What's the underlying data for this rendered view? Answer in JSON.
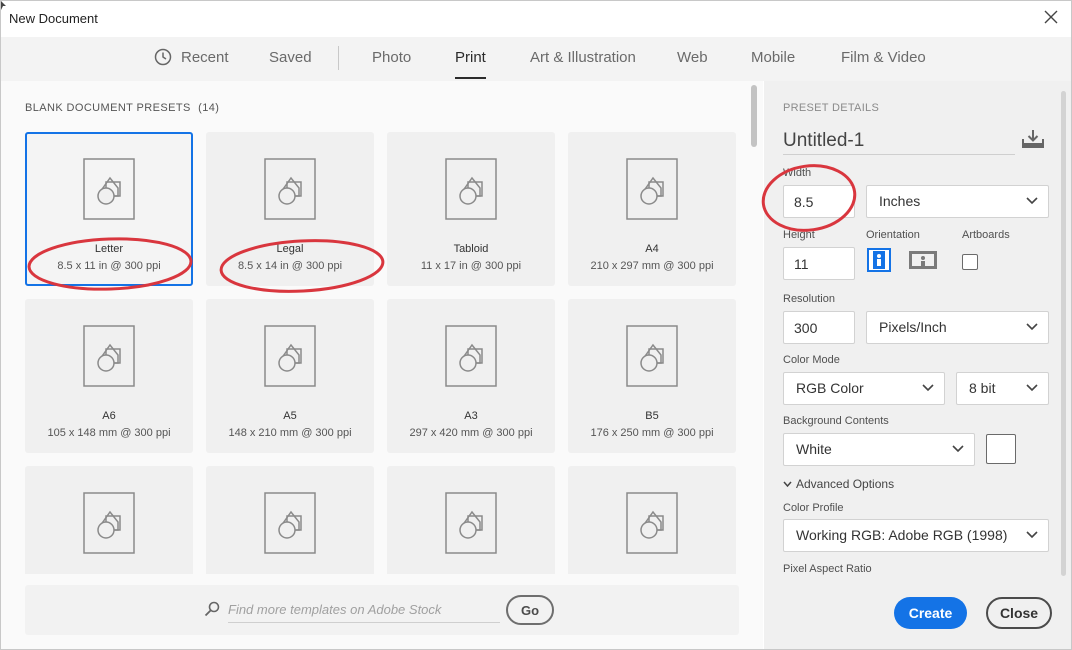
{
  "window": {
    "title": "New Document"
  },
  "tabs": [
    {
      "label": "Recent"
    },
    {
      "label": "Saved"
    },
    {
      "label": "Photo"
    },
    {
      "label": "Print",
      "active": true
    },
    {
      "label": "Art & Illustration"
    },
    {
      "label": "Web"
    },
    {
      "label": "Mobile"
    },
    {
      "label": "Film & Video"
    }
  ],
  "presets": {
    "section_label": "BLANK DOCUMENT PRESETS",
    "count": "(14)",
    "items": [
      {
        "name": "Letter",
        "dims": "8.5 x 11 in @ 300 ppi",
        "selected": true
      },
      {
        "name": "Legal",
        "dims": "8.5 x 14 in @ 300 ppi"
      },
      {
        "name": "Tabloid",
        "dims": "11 x 17 in @ 300 ppi"
      },
      {
        "name": "A4",
        "dims": "210 x 297 mm @ 300 ppi"
      },
      {
        "name": "A6",
        "dims": "105 x 148 mm @ 300 ppi"
      },
      {
        "name": "A5",
        "dims": "148 x 210 mm @ 300 ppi"
      },
      {
        "name": "A3",
        "dims": "297 x 420 mm @ 300 ppi"
      },
      {
        "name": "B5",
        "dims": "176 x 250 mm @ 300 ppi"
      },
      {
        "name": "",
        "dims": ""
      },
      {
        "name": "",
        "dims": ""
      },
      {
        "name": "",
        "dims": ""
      },
      {
        "name": "",
        "dims": ""
      }
    ]
  },
  "search": {
    "placeholder": "Find more templates on Adobe Stock",
    "go_label": "Go"
  },
  "details": {
    "header": "PRESET DETAILS",
    "name": "Untitled-1",
    "width_label": "Width",
    "width_value": "8.5",
    "width_unit": "Inches",
    "height_label": "Height",
    "height_value": "11",
    "orientation_label": "Orientation",
    "artboards_label": "Artboards",
    "resolution_label": "Resolution",
    "resolution_value": "300",
    "resolution_unit": "Pixels/Inch",
    "color_mode_label": "Color Mode",
    "color_mode": "RGB Color",
    "bit_depth": "8 bit",
    "background_label": "Background Contents",
    "background_value": "White",
    "advanced_label": "Advanced Options",
    "color_profile_label": "Color Profile",
    "color_profile": "Working RGB: Adobe RGB (1998)",
    "pixel_aspect_label": "Pixel Aspect Ratio",
    "create_label": "Create",
    "close_label": "Close"
  },
  "colors": {
    "accent": "#1473e6",
    "annotation": "#d9363e"
  }
}
